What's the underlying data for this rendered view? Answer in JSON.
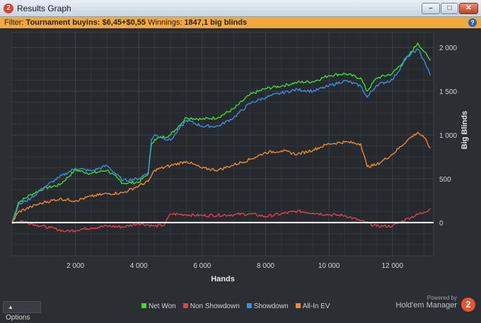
{
  "window": {
    "title": "Results Graph",
    "app_icon_label": "2"
  },
  "filter": {
    "prefix": "Filter:",
    "buyins_label": "Tournament buyins: $6,45+$0,55",
    "winnings_prefix": "Winnings:",
    "winnings_value": "1847,1 big blinds"
  },
  "help_label": "?",
  "options_label": "Options",
  "brand": {
    "powered": "Powered by",
    "name": "Hold'em Manager",
    "logo": "2"
  },
  "chart_data": {
    "type": "line",
    "xlabel": "Hands",
    "ylabel": "Big Blinds",
    "xlim": [
      0,
      13300
    ],
    "ylim": [
      -380,
      2170
    ],
    "xticks": [
      2000,
      4000,
      6000,
      8000,
      10000,
      12000
    ],
    "xtick_labels": [
      "2 000",
      "4 000",
      "6 000",
      "8 000",
      "10 000",
      "12 000"
    ],
    "yticks": [
      0,
      500,
      1000,
      1500,
      2000
    ],
    "ytick_labels": [
      "0",
      "500",
      "1 000",
      "1 500",
      "2 000"
    ],
    "grid": true,
    "legend_position": "bottom",
    "series": [
      {
        "name": "Net Won",
        "color": "#3ddc2f",
        "x": [
          0,
          200,
          600,
          1000,
          1500,
          2000,
          2500,
          3000,
          3500,
          4000,
          4300,
          4400,
          4500,
          5000,
          5500,
          6000,
          6500,
          7000,
          7500,
          8000,
          8500,
          9000,
          9500,
          10000,
          10500,
          11000,
          11200,
          11500,
          12000,
          12500,
          12800,
          13000,
          13200
        ],
        "y": [
          0,
          230,
          320,
          390,
          430,
          600,
          560,
          600,
          450,
          460,
          560,
          900,
          950,
          1000,
          1200,
          1180,
          1200,
          1300,
          1460,
          1530,
          1560,
          1600,
          1610,
          1680,
          1700,
          1650,
          1500,
          1650,
          1700,
          1900,
          2050,
          1950,
          1850
        ]
      },
      {
        "name": "Non Showdown",
        "color": "#e0414a",
        "x": [
          0,
          300,
          800,
          1200,
          1700,
          2500,
          3000,
          3500,
          4000,
          4500,
          4800,
          5000,
          5500,
          6000,
          7000,
          7500,
          8000,
          8500,
          9000,
          9500,
          10000,
          10500,
          11000,
          11500,
          12000,
          12500,
          13000,
          13200
        ],
        "y": [
          0,
          20,
          -30,
          -60,
          -100,
          -60,
          -40,
          -50,
          -10,
          -40,
          -30,
          100,
          90,
          80,
          90,
          100,
          70,
          100,
          130,
          110,
          90,
          80,
          20,
          -40,
          -40,
          50,
          120,
          160
        ]
      },
      {
        "name": "Showdown",
        "color": "#3a8fe0",
        "x": [
          0,
          200,
          600,
          1000,
          1500,
          2000,
          2500,
          3000,
          3500,
          4000,
          4300,
          4400,
          4500,
          5000,
          5500,
          6000,
          6500,
          7000,
          7500,
          8000,
          8500,
          9000,
          9500,
          10000,
          10500,
          11000,
          11200,
          11500,
          12000,
          12500,
          12800,
          13000,
          13200
        ],
        "y": [
          0,
          200,
          280,
          400,
          520,
          620,
          590,
          650,
          480,
          500,
          580,
          950,
          1000,
          940,
          1170,
          1100,
          1100,
          1200,
          1360,
          1430,
          1480,
          1520,
          1500,
          1560,
          1620,
          1560,
          1430,
          1570,
          1630,
          1900,
          1980,
          1850,
          1680
        ]
      },
      {
        "name": "All-In EV",
        "color": "#f08a2c",
        "x": [
          0,
          200,
          600,
          1000,
          1500,
          2000,
          2500,
          3000,
          3500,
          4000,
          4300,
          4500,
          5000,
          5500,
          6000,
          6500,
          7000,
          7500,
          8000,
          8500,
          9000,
          9500,
          10000,
          10500,
          11000,
          11200,
          11500,
          12000,
          12500,
          12800,
          13000,
          13200
        ],
        "y": [
          0,
          120,
          180,
          230,
          270,
          250,
          300,
          330,
          340,
          420,
          470,
          600,
          650,
          700,
          620,
          600,
          660,
          720,
          800,
          820,
          780,
          830,
          900,
          920,
          900,
          640,
          660,
          780,
          950,
          1030,
          970,
          850
        ]
      },
      {
        "name": "",
        "color": "#ffffff",
        "x": [
          0,
          13300
        ],
        "y": [
          0,
          0
        ]
      }
    ]
  }
}
